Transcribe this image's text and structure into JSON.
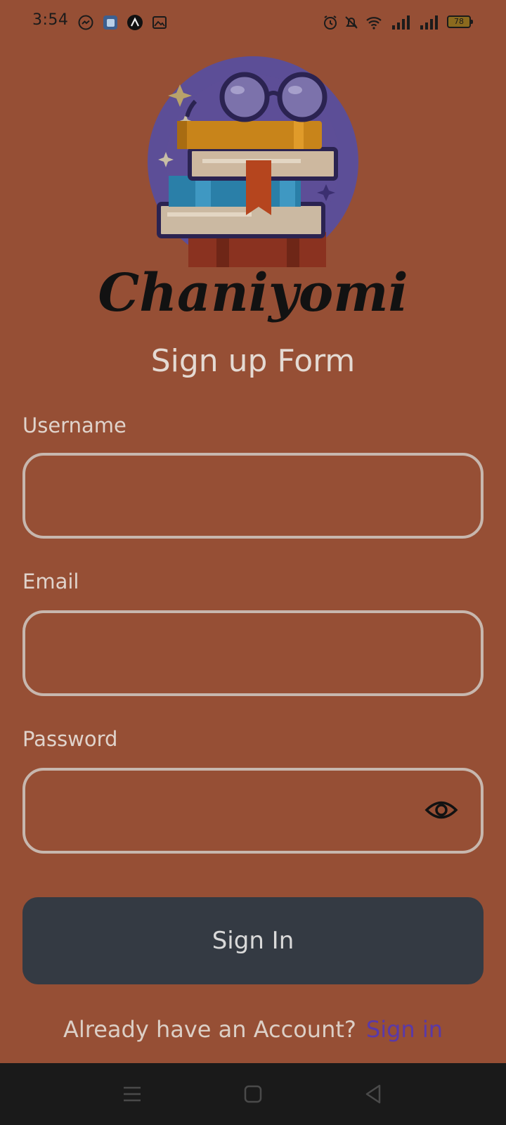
{
  "status_bar": {
    "time": "3:54",
    "battery": "78",
    "left_icons": [
      "messenger-icon",
      "app-icon",
      "arch-icon",
      "gallery-icon"
    ],
    "right_icons": [
      "alarm-icon",
      "mute-icon",
      "wifi-icon",
      "signal-icon",
      "signal-icon"
    ]
  },
  "brand": {
    "name": "Chaniyomi",
    "logo_icon": "books-with-glasses-icon"
  },
  "form": {
    "title": "Sign up Form",
    "username_label": "Username",
    "username_value": "",
    "email_label": "Email",
    "email_value": "",
    "password_label": "Password",
    "password_value": "",
    "password_toggle_icon": "eye-icon",
    "submit_label": "Sign In"
  },
  "footer": {
    "prompt": "Already have an Account?",
    "link": "Sign in"
  },
  "nav_bar": {
    "icons": [
      "menu-icon",
      "home-icon",
      "back-icon"
    ]
  },
  "colors": {
    "background": "#964F35",
    "button": "#343A43",
    "link": "#5A39A8",
    "nav_bar": "#1A1A1A"
  }
}
